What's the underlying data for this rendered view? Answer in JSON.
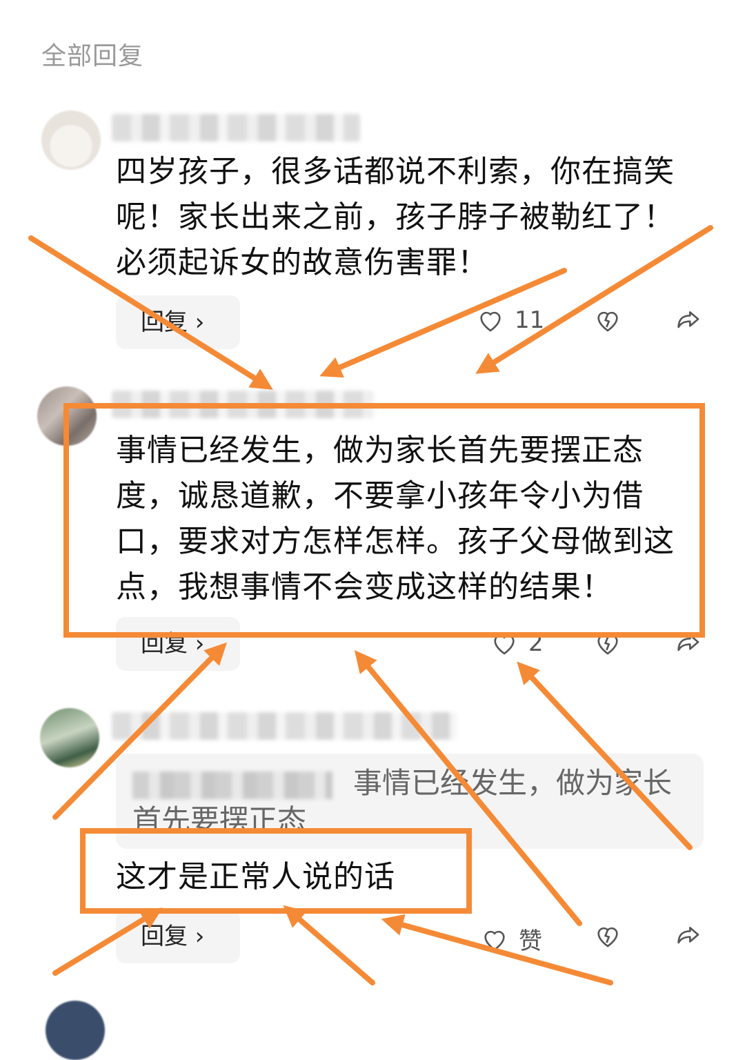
{
  "section_title": "全部回复",
  "comments": [
    {
      "text": "四岁孩子，很多话都说不利索，你在搞笑呢！家长出来之前，孩子脖子被勒红了！必须起诉女的故意伤害罪！",
      "reply_label": "回复 ›",
      "like_count": "11"
    },
    {
      "text": "事情已经发生，做为家长首先要摆正态度，诚恳道歉，不要拿小孩年令小为借口，要求对方怎样怎样。孩子父母做到这点，我想事情不会变成这样的结果！",
      "reply_label": "回复 ›",
      "like_count": "2"
    },
    {
      "quote_text": "事情已经发生，做为家长首先要摆正态",
      "text": "这才是正常人说的话",
      "reply_label": "回复 ›",
      "like_count": "赞"
    }
  ],
  "icons": {
    "like": "heart-icon",
    "dislike": "broken-heart-icon",
    "share": "share-arrow-icon"
  },
  "colors": {
    "annotation": "#f58a36",
    "muted_text": "#999999",
    "reply_bg": "#f4f4f4"
  }
}
